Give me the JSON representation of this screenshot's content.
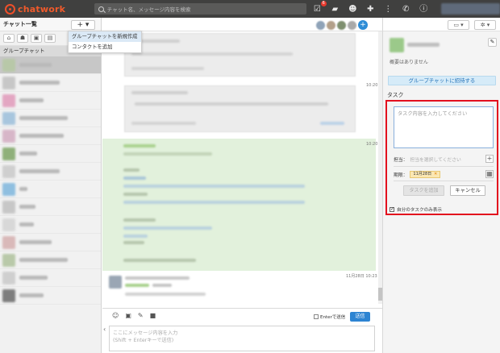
{
  "app": {
    "logo_text": "chatwork",
    "search_placeholder": "チャット名、メッセージ内容を検索",
    "notification_count": "6"
  },
  "sidebar": {
    "header_title": "チャット一覧",
    "add_button_label": "+ ▾",
    "group_label": "グループチャット",
    "filter_icons": [
      "home-icon",
      "group-icon",
      "dm-icon",
      "task-icon"
    ]
  },
  "dropdown": {
    "items": [
      "グループチャットを新規作成",
      "コンタクトを追加"
    ]
  },
  "chat": {
    "timestamps": [
      "10:20",
      "10:20",
      "11月28日 10:23"
    ]
  },
  "composer": {
    "enter_label": "Enterで送信",
    "send_label": "送信",
    "placeholder_line1": "ここにメッセージ内容を入力",
    "placeholder_line2": "(Shift + Enterキーで送信)"
  },
  "right_panel": {
    "summary": "概要はありません",
    "invite_label": "グループチャットに招待する",
    "task_section_title": "タスク",
    "task_placeholder": "タスク内容を入力してください",
    "assignee_label": "担当：",
    "assignee_placeholder": "担当を選択してください",
    "due_label": "期限：",
    "due_value": "11月28日",
    "add_task_label": "タスクを追加",
    "cancel_label": "キャンセル",
    "mine_only_label": "自分のタスクのみ表示"
  },
  "colors": {
    "topbar": "#40403f",
    "accent_orange": "#f05a2b",
    "highlight_red": "#e3101e",
    "send_blue": "#2d84d2",
    "message_green": "#e2f1dc"
  }
}
